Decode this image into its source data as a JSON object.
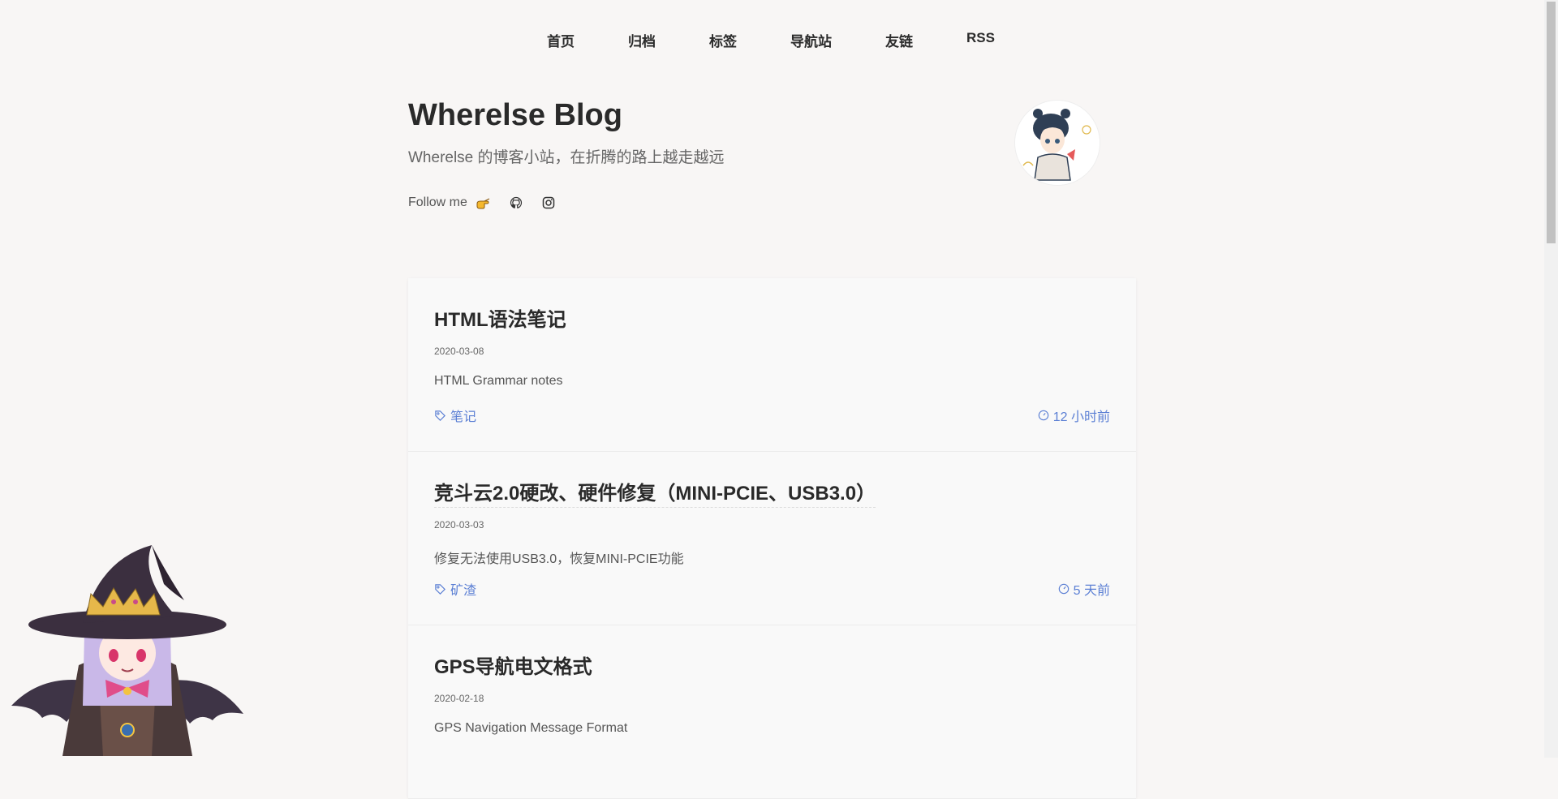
{
  "nav": [
    {
      "label": "首页"
    },
    {
      "label": "归档"
    },
    {
      "label": "标签"
    },
    {
      "label": "导航站"
    },
    {
      "label": "友链"
    },
    {
      "label": "RSS"
    }
  ],
  "site": {
    "title": "Wherelse Blog",
    "subtitle": "Wherelse 的博客小站，在折腾的路上越走越远",
    "follow_label": "Follow me",
    "follow_icons": [
      "pointing-hand-icon",
      "github-icon",
      "instagram-icon"
    ]
  },
  "posts": [
    {
      "title": "HTML语法笔记",
      "date": "2020-03-08",
      "desc": "HTML Grammar notes",
      "tag": "笔记",
      "time": "12 小时前"
    },
    {
      "title": "竞斗云2.0硬改、硬件修复（MINI-PCIE、USB3.0）",
      "date": "2020-03-03",
      "desc": "修复无法使用USB3.0，恢复MINI-PCIE功能",
      "tag": "矿渣",
      "time": "5 天前"
    },
    {
      "title": "GPS导航电文格式",
      "date": "2020-02-18",
      "desc": "GPS Navigation Message Format",
      "tag": "",
      "time": ""
    }
  ],
  "colors": {
    "accent": "#5b7fd4",
    "background": "#f8f6f5"
  }
}
